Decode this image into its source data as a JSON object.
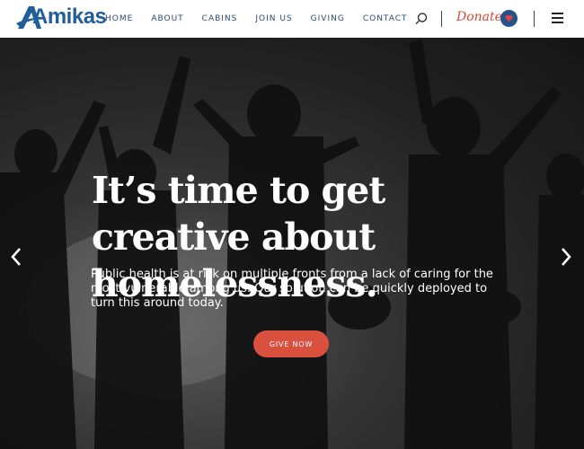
{
  "brand": {
    "logo_text": "Amikas",
    "color": "#1f5d9b"
  },
  "nav": {
    "items": [
      {
        "label": "HOME"
      },
      {
        "label": "ABOUT"
      },
      {
        "label": "CABINS"
      },
      {
        "label": "JOIN US"
      },
      {
        "label": "GIVING"
      },
      {
        "label": "CONTACT"
      }
    ]
  },
  "header": {
    "donate_label": "Donate",
    "search_icon": "search-icon",
    "heart_icon": "heart-icon",
    "menu_icon": "hamburger-menu-icon"
  },
  "hero": {
    "title": "It’s time to get creative about homelessness.",
    "subtitle": "Public health is at risk on multiple fronts from a lack of caring for the most vulnerable among us. Our solution can be quickly deployed to turn this around today.",
    "cta_label": "GIVE NOW",
    "prev_icon": "chevron-left-icon",
    "next_icon": "chevron-right-icon"
  },
  "colors": {
    "accent": "#d9503f",
    "heart_button": "#26528a",
    "nav_text": "#2c4b6e"
  }
}
